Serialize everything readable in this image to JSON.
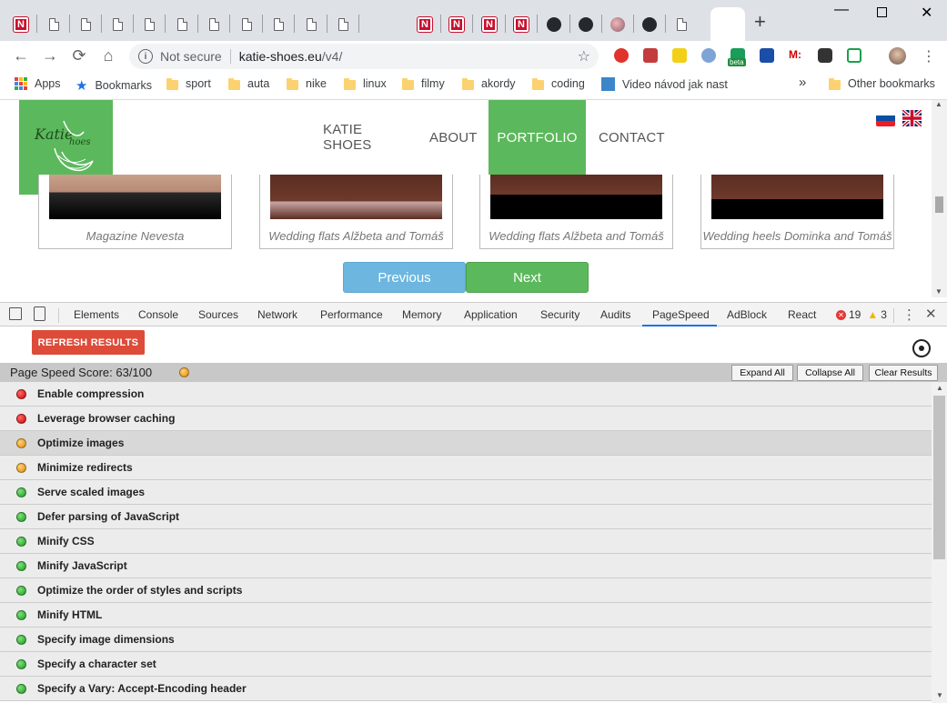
{
  "browser": {
    "tabs": [
      {
        "icon": "n-icon"
      },
      {
        "icon": "document-icon"
      },
      {
        "icon": "document-icon"
      },
      {
        "icon": "document-icon"
      },
      {
        "icon": "document-icon"
      },
      {
        "icon": "document-icon"
      },
      {
        "icon": "document-icon"
      },
      {
        "icon": "document-icon"
      },
      {
        "icon": "document-icon"
      },
      {
        "icon": "document-icon"
      },
      {
        "icon": "document-icon"
      },
      {
        "icon": "n-icon"
      },
      {
        "icon": "n-icon"
      },
      {
        "icon": "n-icon"
      },
      {
        "icon": "n-icon"
      },
      {
        "icon": "github-icon"
      },
      {
        "icon": "github-icon"
      },
      {
        "icon": "ball-icon"
      },
      {
        "icon": "github-icon"
      },
      {
        "icon": "document-icon"
      },
      {
        "icon": "active-tab"
      }
    ],
    "close_tab": "✕",
    "new_tab": "+",
    "omnibox": {
      "security_label": "Not secure",
      "url_host": "katie-shoes.eu",
      "url_path": "/v4/"
    },
    "extension_beta_badge": "beta",
    "bookmarks": {
      "apps": "Apps",
      "bookmarks": "Bookmarks",
      "items": [
        "sport",
        "auta",
        "nike",
        "linux",
        "filmy",
        "akordy",
        "coding"
      ],
      "video": "Video návod jak nast",
      "overflow": "»",
      "other": "Other bookmarks"
    }
  },
  "site": {
    "menu": [
      "KATIE SHOES",
      "ABOUT",
      "PORTFOLIO",
      "CONTACT"
    ],
    "active_menu": "PORTFOLIO",
    "cards": [
      {
        "caption": "Magazine Nevesta"
      },
      {
        "caption": "Wedding flats Alžbeta and Tomáš"
      },
      {
        "caption": "Wedding flats Alžbeta and Tomáš"
      },
      {
        "caption": "Wedding heels Dominka and Tomáš"
      }
    ],
    "prev_label": "Previous",
    "next_label": "Next"
  },
  "devtools": {
    "tabs": [
      "Elements",
      "Console",
      "Sources",
      "Network",
      "Performance",
      "Memory",
      "Application",
      "Security",
      "Audits",
      "PageSpeed",
      "AdBlock",
      "React"
    ],
    "active_tab": "PageSpeed",
    "errors": "19",
    "warnings": "3",
    "refresh_label": "REFRESH RESULTS",
    "score_text": "Page Speed Score: 63/100",
    "score_value": 63,
    "expand_all": "Expand All",
    "collapse_all": "Collapse All",
    "clear_results": "Clear Results",
    "rules": [
      {
        "label": "Enable compression",
        "status": "red"
      },
      {
        "label": "Leverage browser caching",
        "status": "red"
      },
      {
        "label": "Optimize images",
        "status": "orange"
      },
      {
        "label": "Minimize redirects",
        "status": "orange"
      },
      {
        "label": "Serve scaled images",
        "status": "green"
      },
      {
        "label": "Defer parsing of JavaScript",
        "status": "green"
      },
      {
        "label": "Minify CSS",
        "status": "green"
      },
      {
        "label": "Minify JavaScript",
        "status": "green"
      },
      {
        "label": "Optimize the order of styles and scripts",
        "status": "green"
      },
      {
        "label": "Minify HTML",
        "status": "green"
      },
      {
        "label": "Specify image dimensions",
        "status": "green"
      },
      {
        "label": "Specify a character set",
        "status": "green"
      },
      {
        "label": "Specify a Vary: Accept-Encoding header",
        "status": "green"
      }
    ],
    "colors": {
      "red": "#cc0000",
      "orange": "#e08a00",
      "green": "#1c9a1c",
      "accent": "#5cb85c"
    }
  }
}
